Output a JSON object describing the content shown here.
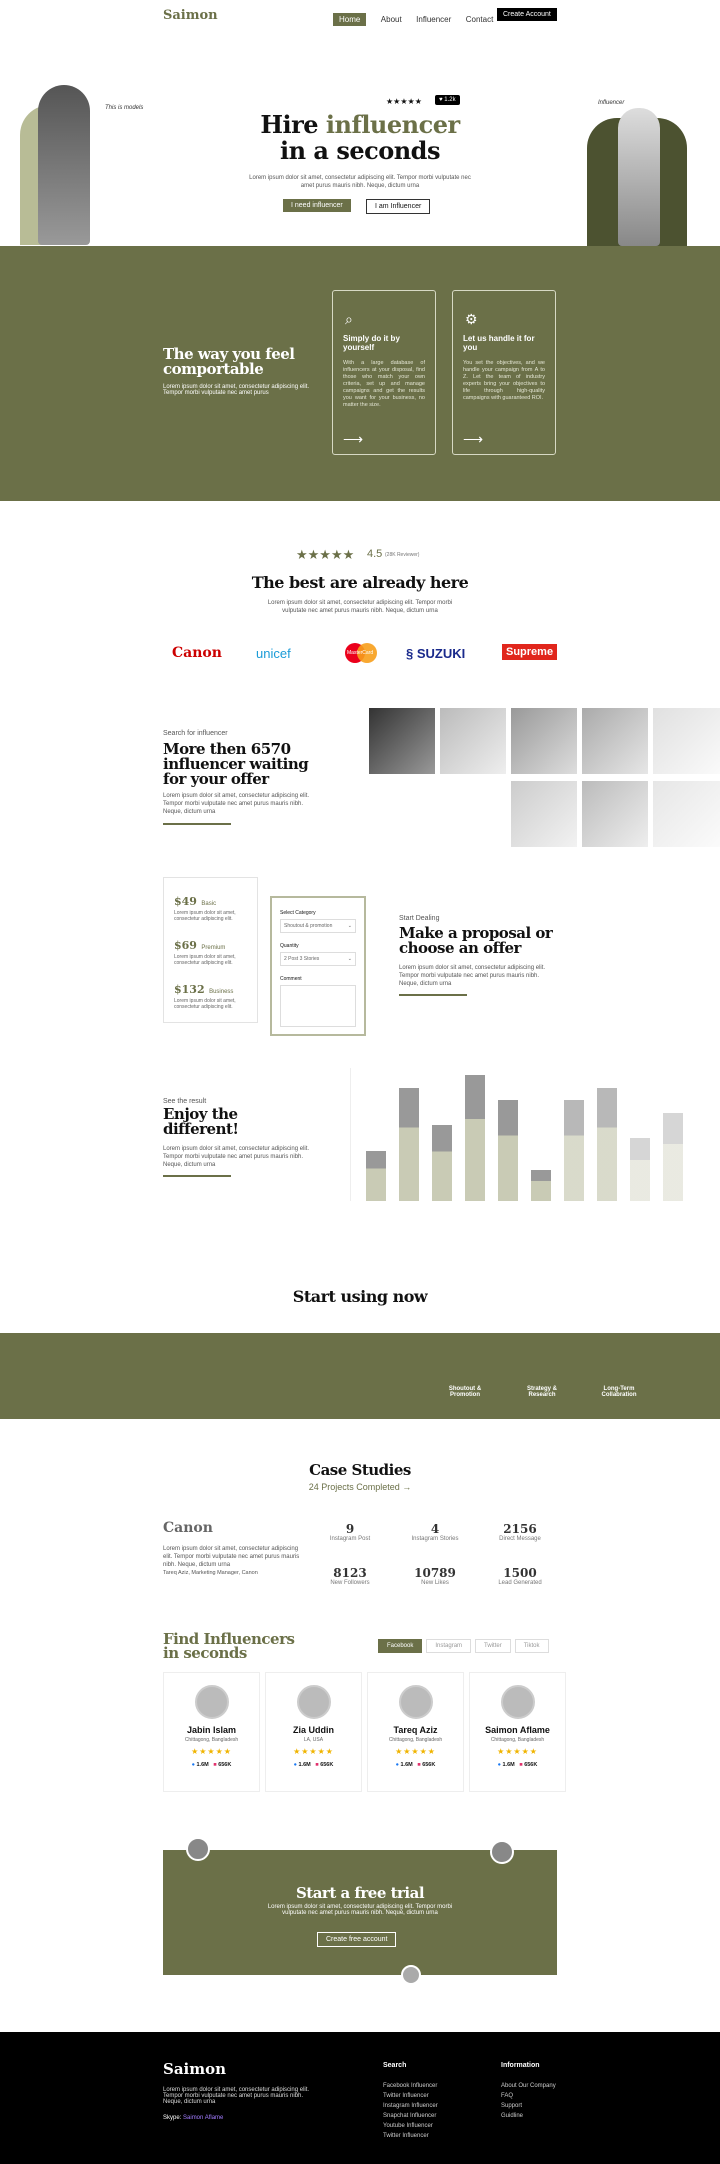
{
  "nav": {
    "logo": "Saimon",
    "items": [
      "Home",
      "About",
      "Influencer",
      "Contact"
    ],
    "cta": "Create Account"
  },
  "hero": {
    "title_a": "Hire ",
    "title_b": "influencer",
    "title_c": "in a seconds",
    "desc": "Lorem ipsum dolor sit amet, consectetur adipiscing elit. Tempor morbi vulputate nec amet purus mauris nibh. Neque, dictum urna",
    "btn1": "I need influencer",
    "btn2": "I am Influencer",
    "likes": "1.2k",
    "tag_left": "This is models",
    "tag_right": "Influencer",
    "stars": "★★★★★"
  },
  "band": {
    "title": "The way you feel comportable",
    "desc": "Lorem ipsum dolor sit amet, consectetur adipiscing elit. Tempor morbi vulputate nec amet purus",
    "card1_title": "Simply do it by yourself",
    "card1_desc": "With a large database of influencers at your disposal, find those who match your own criteria, set up and manage campaigns and get the results you want for your business, no matter the size.",
    "card2_title": "Let us handle it for you",
    "card2_desc": "You set the objectives, and we handle your campaign from A to Z. Let the team of industry experts bring your objectives to life through high-quality campaigns with guaranteed ROI.",
    "arrow": "⟶"
  },
  "reviews": {
    "stars": "★★★★★",
    "score": "4.5",
    "count": "(28K Reviewer)",
    "title": "The best are already here",
    "desc": "Lorem ipsum dolor sit amet, consectetur adipiscing elit. Tempor morbi vulputate nec amet purus mauris nibh. Neque, dictum urna",
    "brands": [
      "Canon",
      "unicef",
      "MasterCard",
      "SUZUKI",
      "Supreme"
    ]
  },
  "search": {
    "kicker": "Search for influencer",
    "title": "More then 6570 influencer waiting for your offer",
    "desc": "Lorem ipsum dolor sit amet, consectetur adipiscing elit. Tempor morbi vulputate nec amet purus mauris nibh. Neque, dictum urna"
  },
  "pricing": [
    {
      "price": "$49",
      "plan": "Basic",
      "desc": "Lorem ipsum dolor sit amet, consectetur adipiscing elit."
    },
    {
      "price": "$69",
      "plan": "Premium",
      "desc": "Lorem ipsum dolor sit amet, consectetur adipiscing elit."
    },
    {
      "price": "$132",
      "plan": "Business",
      "desc": "Lorem ipsum dolor sit amet, consectetur adipiscing elit."
    }
  ],
  "form": {
    "cat_label": "Select Category",
    "cat_value": "Shoutout & promotion",
    "qty_label": "Quantity",
    "qty_value": "2 Post 3 Stories",
    "comment_label": "Comment"
  },
  "deal": {
    "kicker": "Start Dealing",
    "title": "Make a proposal or choose an offer",
    "desc": "Lorem ipsum dolor sit amet, consectetur adipiscing elit. Tempor morbi vulputate nec amet purus mauris nibh. Neque, dictum urna"
  },
  "result": {
    "kicker": "See the result",
    "title": "Enjoy the different!",
    "desc": "Lorem ipsum dolor sit amet, consectetur adipiscing elit. Tempor morbi vulputate nec amet purus mauris nibh. Neque, dictum urna"
  },
  "chart_data": {
    "type": "bar",
    "title": "",
    "xlabel": "",
    "ylabel": "",
    "values": [
      4,
      9,
      6,
      10,
      8,
      2.5,
      8,
      9,
      5,
      7
    ],
    "ylim": [
      0,
      10
    ]
  },
  "start": {
    "title": "Start using now",
    "services": [
      "Shoutout & Promotion",
      "Strategy & Research",
      "Long-Term Collabration"
    ]
  },
  "cases": {
    "title": "Case Studies",
    "sub": "24 Projects Completed →",
    "brand": "Canon",
    "desc": "Lorem ipsum dolor sit amet, consectetur adipiscing elit. Tempor morbi vulputate nec amet purus mauris nibh. Neque, dictum urna",
    "author": "Tareq Aziz, Marketing Manager, Canon",
    "stats": [
      {
        "n": "9",
        "l": "Instagram Post"
      },
      {
        "n": "4",
        "l": "Instagram Stories"
      },
      {
        "n": "2156",
        "l": "Direct Message"
      },
      {
        "n": "8123",
        "l": "New Followers"
      },
      {
        "n": "10789",
        "l": "New Likes"
      },
      {
        "n": "1500",
        "l": "Lead Generated"
      }
    ]
  },
  "find": {
    "title": "Find Influencers in seconds",
    "tabs": [
      "Facebook",
      "Instagram",
      "Twitter",
      "Tiktok"
    ],
    "people": [
      {
        "name": "Jabin Islam",
        "loc": "Chittagong, Bangladesh"
      },
      {
        "name": "Zia Uddin",
        "loc": "LA, USA"
      },
      {
        "name": "Tareq Aziz",
        "loc": "Chittagong, Bangladesh"
      },
      {
        "name": "Saimon Aflame",
        "loc": "Chittagong, Bangladesh"
      }
    ],
    "stars": "★★★★★",
    "fb": "1.6M",
    "ig": "656K"
  },
  "trial": {
    "title": "Start a free trial",
    "desc": "Lorem ipsum dolor sit amet, consectetur adipiscing elit. Tempor morbi vulputate nec amet purus mauris nibh. Neque, dictum urna",
    "btn": "Create free account"
  },
  "footer": {
    "logo": "Saimon",
    "desc": "Lorem ipsum dolor sit amet, consectetur adipiscing elit. Tempor morbi vulputate nec amet purus mauris nibh. Neque, dictum urna",
    "skype_label": "Skype:",
    "skype": "Saimon Aflame",
    "search_title": "Search",
    "search_links": [
      "Facebook Influencer",
      "Twitter Influencer",
      "Instagram Influencer",
      "Snapchat Influencer",
      "Youtube Influencer",
      "Twitter Influencer"
    ],
    "info_title": "Information",
    "info_links": [
      "About Our Company",
      "FAQ",
      "Support",
      "Guidline"
    ]
  }
}
